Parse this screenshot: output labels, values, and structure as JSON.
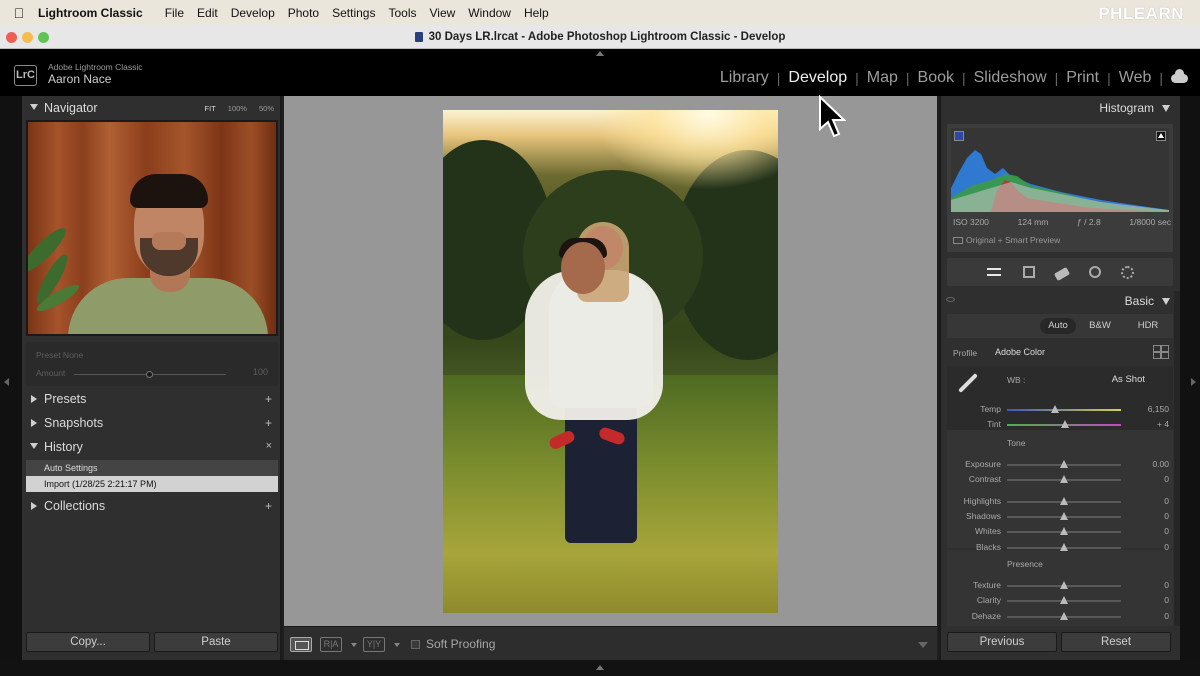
{
  "menubar": {
    "app": "Lightroom Classic",
    "items": [
      "File",
      "Edit",
      "Develop",
      "Photo",
      "Settings",
      "Tools",
      "View",
      "Window",
      "Help"
    ],
    "brand": "PHLEARN"
  },
  "window": {
    "title": "30 Days LR.lrcat - Adobe Photoshop Lightroom Classic - Develop"
  },
  "identity": {
    "logo": "LrC",
    "subtitle": "Adobe Lightroom Classic",
    "user": "Aaron Nace"
  },
  "modules": [
    "Library",
    "Develop",
    "Map",
    "Book",
    "Slideshow",
    "Print",
    "Web"
  ],
  "active_module": "Develop",
  "left_panel": {
    "navigator": {
      "title": "Navigator",
      "zoom": [
        "FIT",
        "100%",
        "50%"
      ]
    },
    "preset_label": "Preset  None",
    "amount_label": "Amount",
    "amount_value": "100",
    "amount_level": 0.5,
    "sections": {
      "presets": "Presets",
      "snapshots": "Snapshots",
      "history": "History",
      "collections": "Collections"
    },
    "history_items": [
      "Auto Settings",
      "Import (1/28/25 2:21:17 PM)"
    ],
    "buttons": {
      "copy": "Copy...",
      "paste": "Paste"
    }
  },
  "toolbar": {
    "ra": "R|A",
    "yy": "Y|Y",
    "soft_proofing": "Soft Proofing"
  },
  "right_panel": {
    "histogram": {
      "title": "Histogram",
      "iso": "ISO 3200",
      "focal": "124 mm",
      "aperture": "ƒ / 2.8",
      "shutter": "1/8000 sec",
      "preview": "Original + Smart Preview"
    },
    "basic": {
      "title": "Basic",
      "treatments": [
        "Auto",
        "B&W",
        "HDR"
      ],
      "profile_label": "Profile",
      "profile_value": "Adobe Color",
      "wb_label": "WB :",
      "wb_value": "As Shot",
      "tone_label": "Tone",
      "presence_label": "Presence",
      "sliders": [
        {
          "name": "Temp",
          "value": "6,150",
          "level": 0.42
        },
        {
          "name": "Tint",
          "value": "+ 4",
          "level": 0.51
        },
        {
          "name": "Exposure",
          "value": "0.00",
          "level": 0.5
        },
        {
          "name": "Contrast",
          "value": "0",
          "level": 0.5
        },
        {
          "name": "Highlights",
          "value": "0",
          "level": 0.5
        },
        {
          "name": "Shadows",
          "value": "0",
          "level": 0.5
        },
        {
          "name": "Whites",
          "value": "0",
          "level": 0.5
        },
        {
          "name": "Blacks",
          "value": "0",
          "level": 0.5
        },
        {
          "name": "Texture",
          "value": "0",
          "level": 0.5
        },
        {
          "name": "Clarity",
          "value": "0",
          "level": 0.5
        },
        {
          "name": "Dehaze",
          "value": "0",
          "level": 0.5
        }
      ]
    },
    "buttons": {
      "previous": "Previous",
      "reset": "Reset"
    }
  },
  "colors": {
    "accent_bg": "#2f2f2f",
    "canvas": "#979797",
    "histogram_blue": "#2f7ad0",
    "histogram_green": "#3c9a45",
    "histogram_red": "#b33a33"
  }
}
